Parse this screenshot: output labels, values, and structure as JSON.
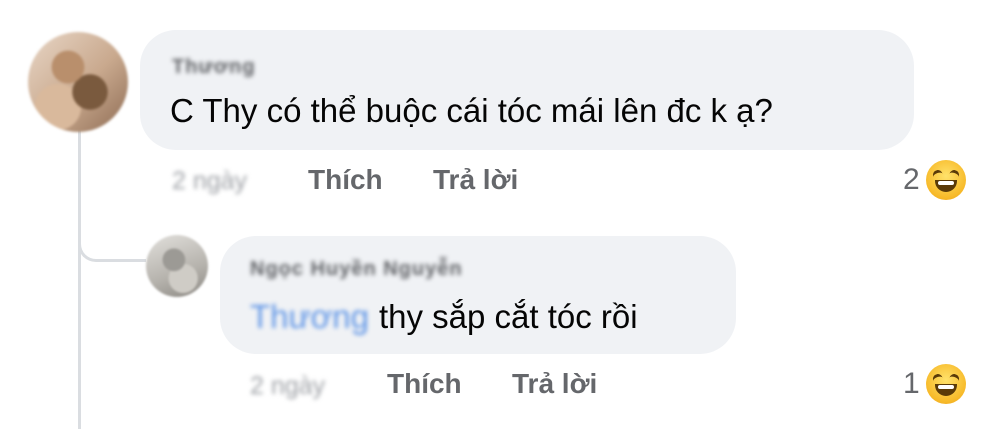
{
  "comments": [
    {
      "author": "Thương",
      "text": "C Thy có thể buộc cái tóc mái lên đc k ạ?",
      "time": "2 ngày",
      "like_label": "Thích",
      "reply_label": "Trả lời",
      "reaction_count": "2",
      "reaction_icon": "haha-emoji-icon"
    },
    {
      "author": "Ngọc Huyền Nguyễn",
      "mention": "Thương",
      "text": "thy sắp cắt tóc rồi",
      "time": "2 ngày",
      "like_label": "Thích",
      "reply_label": "Trả lời",
      "reaction_count": "1",
      "reaction_icon": "haha-emoji-icon"
    }
  ],
  "colors": {
    "bubble": "#f0f2f5",
    "mention": "#5f95e6",
    "meta": "#65676b",
    "thread_line": "#dadde1"
  }
}
